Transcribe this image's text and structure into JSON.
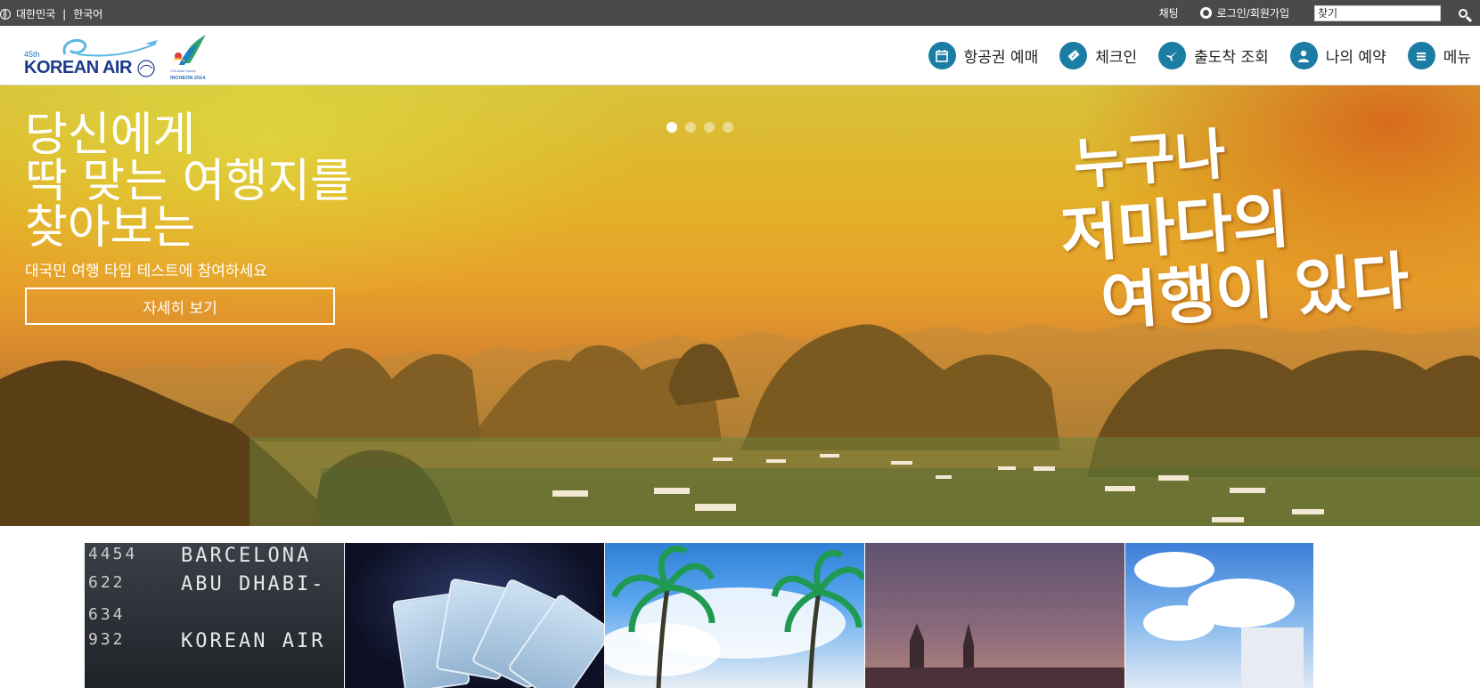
{
  "topbar": {
    "locale_country": "대한민국",
    "locale_separator": "|",
    "locale_language": "한국어",
    "chat": "채팅",
    "login": "로그인/회원가입",
    "search_placeholder": "찾기"
  },
  "header": {
    "logo_45th": "45th",
    "logo_text": "KOREAN AIR",
    "games_caption": "INCHEON 2014",
    "games_sub": "17th Asian Games",
    "nav": [
      {
        "label": "항공권 예매",
        "icon": "calendar-icon"
      },
      {
        "label": "체크인",
        "icon": "ticket-icon"
      },
      {
        "label": "출도착 조회",
        "icon": "airplane-icon"
      },
      {
        "label": "나의 예약",
        "icon": "person-icon"
      },
      {
        "label": "메뉴",
        "icon": "menu-icon"
      }
    ]
  },
  "hero": {
    "title_line1": "당신에게",
    "title_line2": "딱 맞는 여행지를",
    "title_line3": "찾아보는",
    "subtitle": "대국민 여행 타입 테스트에 참여하세요",
    "button": "자세히 보기",
    "slides_count": 4,
    "active_slide": 1,
    "slogan_line1": "누구나",
    "slogan_line2": "저마다의",
    "slogan_line3": "여행이 있다"
  },
  "thumbnails": {
    "board_rows": [
      {
        "num": "4454",
        "city": "BARCELONA"
      },
      {
        "num": "622",
        "city": "ABU DHABI-"
      },
      {
        "num": "634",
        "city": ""
      },
      {
        "num": "932",
        "city": "KOREAN AIR"
      }
    ],
    "card_label": "KOREAN AIR"
  },
  "colors": {
    "topbar_bg": "#4a4a4a",
    "nav_icon_bg": "#1b7da3",
    "logo_blue": "#1b3a8a"
  }
}
